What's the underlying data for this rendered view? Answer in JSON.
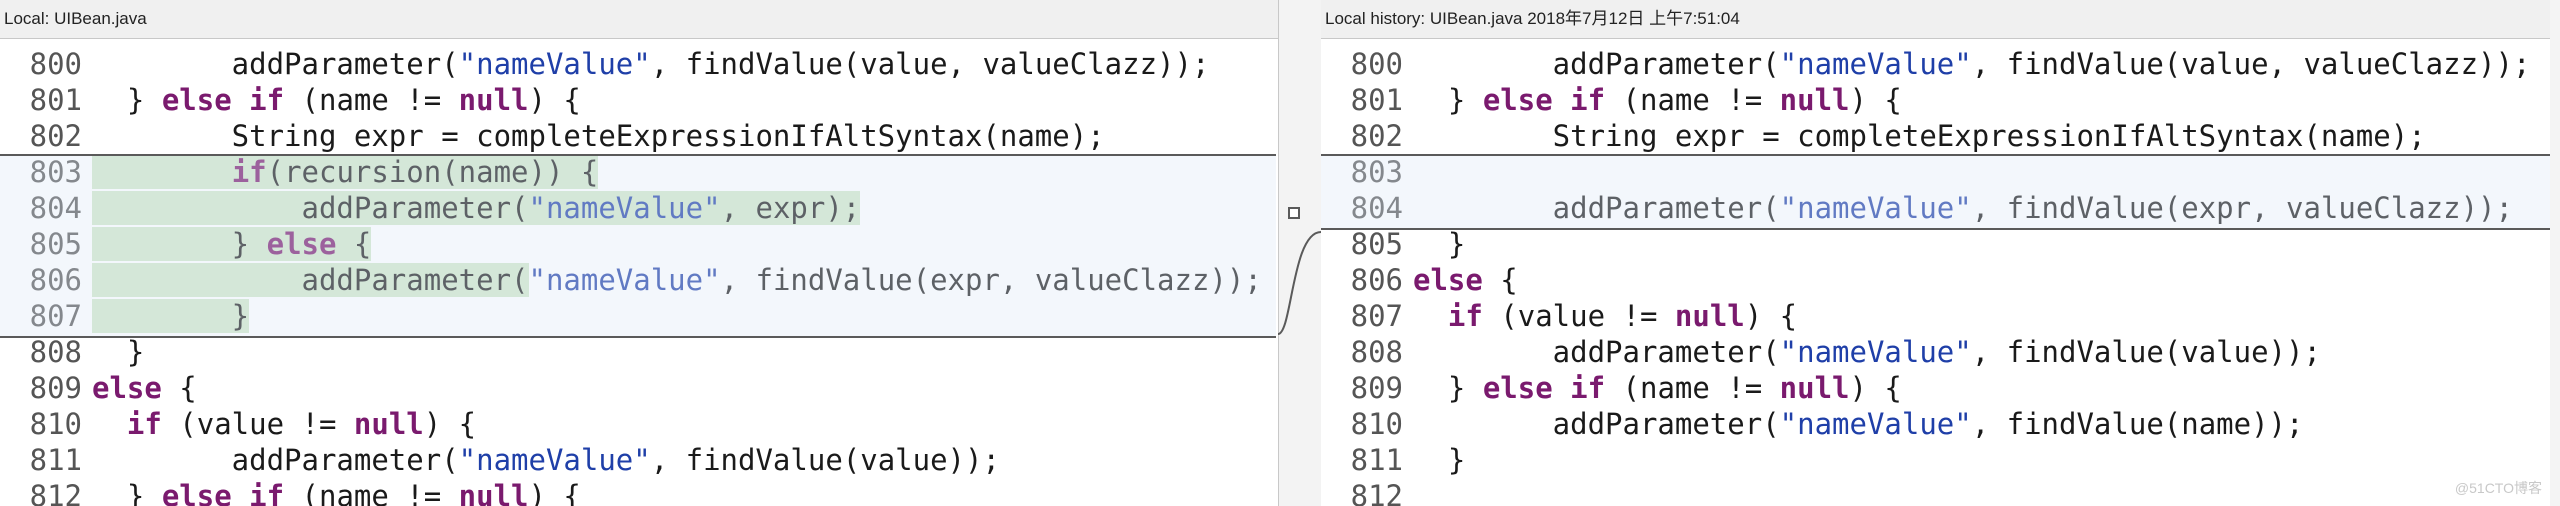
{
  "left": {
    "title": "Local: UIBean.java",
    "lines": [
      {
        "num": "800",
        "parts": [
          {
            "t": "        addParameter(",
            "c": ""
          },
          {
            "t": "\"nameValue\"",
            "c": "str"
          },
          {
            "t": ", findValue(value, valueClazz));",
            "c": ""
          }
        ]
      },
      {
        "num": "801",
        "parts": [
          {
            "t": "  } ",
            "c": ""
          },
          {
            "t": "else if",
            "c": "kw"
          },
          {
            "t": " (name != ",
            "c": ""
          },
          {
            "t": "null",
            "c": "kw"
          },
          {
            "t": ") {",
            "c": ""
          }
        ]
      },
      {
        "num": "802",
        "parts": [
          {
            "t": "        String expr = completeExpressionIfAltSyntax(name);",
            "c": ""
          }
        ]
      },
      {
        "num": "803",
        "parts": [
          {
            "t": "        ",
            "c": "hl"
          },
          {
            "t": "if",
            "c": "kw hl"
          },
          {
            "t": "(recursion(name)) {",
            "c": "hl"
          }
        ]
      },
      {
        "num": "804",
        "parts": [
          {
            "t": "            addParameter(",
            "c": "hl"
          },
          {
            "t": "\"nameValue\"",
            "c": "str hl"
          },
          {
            "t": ", expr);",
            "c": "hl"
          }
        ]
      },
      {
        "num": "805",
        "parts": [
          {
            "t": "        } ",
            "c": "hl"
          },
          {
            "t": "else",
            "c": "kw hl"
          },
          {
            "t": " {",
            "c": "hl"
          }
        ]
      },
      {
        "num": "806",
        "parts": [
          {
            "t": "            addParameter(",
            "c": "hl"
          },
          {
            "t": "\"nameValue\"",
            "c": "str"
          },
          {
            "t": ", findValue(expr, valueClazz));",
            "c": ""
          }
        ]
      },
      {
        "num": "807",
        "parts": [
          {
            "t": "        }",
            "c": "hl"
          }
        ]
      },
      {
        "num": "808",
        "parts": [
          {
            "t": "  }",
            "c": ""
          }
        ]
      },
      {
        "num": "809",
        "parts": [
          {
            "t": "else",
            "c": "kw"
          },
          {
            "t": " {",
            "c": ""
          }
        ]
      },
      {
        "num": "810",
        "parts": [
          {
            "t": "  ",
            "c": ""
          },
          {
            "t": "if",
            "c": "kw"
          },
          {
            "t": " (value != ",
            "c": ""
          },
          {
            "t": "null",
            "c": "kw"
          },
          {
            "t": ") {",
            "c": ""
          }
        ]
      },
      {
        "num": "811",
        "parts": [
          {
            "t": "        addParameter(",
            "c": ""
          },
          {
            "t": "\"nameValue\"",
            "c": "str"
          },
          {
            "t": ", findValue(value));",
            "c": ""
          }
        ]
      },
      {
        "num": "812",
        "parts": [
          {
            "t": "  } ",
            "c": ""
          },
          {
            "t": "else if",
            "c": "kw"
          },
          {
            "t": " (name != ",
            "c": ""
          },
          {
            "t": "null",
            "c": "kw"
          },
          {
            "t": ") {",
            "c": ""
          }
        ]
      }
    ]
  },
  "right": {
    "title": "Local history: UIBean.java 2018年7月12日 上午7:51:04",
    "lines": [
      {
        "num": "800",
        "parts": [
          {
            "t": "        addParameter(",
            "c": ""
          },
          {
            "t": "\"nameValue\"",
            "c": "str"
          },
          {
            "t": ", findValue(value, valueClazz));",
            "c": ""
          }
        ]
      },
      {
        "num": "801",
        "parts": [
          {
            "t": "  } ",
            "c": ""
          },
          {
            "t": "else if",
            "c": "kw"
          },
          {
            "t": " (name != ",
            "c": ""
          },
          {
            "t": "null",
            "c": "kw"
          },
          {
            "t": ") {",
            "c": ""
          }
        ]
      },
      {
        "num": "802",
        "parts": [
          {
            "t": "        String expr = completeExpressionIfAltSyntax(name);",
            "c": ""
          }
        ]
      },
      {
        "num": "803",
        "parts": []
      },
      {
        "num": "804",
        "parts": [
          {
            "t": "        addParameter(",
            "c": ""
          },
          {
            "t": "\"nameValue\"",
            "c": "str"
          },
          {
            "t": ", findValue(expr, valueClazz));",
            "c": ""
          }
        ]
      },
      {
        "num": "805",
        "parts": [
          {
            "t": "  }",
            "c": ""
          }
        ]
      },
      {
        "num": "806",
        "parts": [
          {
            "t": "else",
            "c": "kw"
          },
          {
            "t": " {",
            "c": ""
          }
        ]
      },
      {
        "num": "807",
        "parts": [
          {
            "t": "  ",
            "c": ""
          },
          {
            "t": "if",
            "c": "kw"
          },
          {
            "t": " (value != ",
            "c": ""
          },
          {
            "t": "null",
            "c": "kw"
          },
          {
            "t": ") {",
            "c": ""
          }
        ]
      },
      {
        "num": "808",
        "parts": [
          {
            "t": "        addParameter(",
            "c": ""
          },
          {
            "t": "\"nameValue\"",
            "c": "str"
          },
          {
            "t": ", findValue(value));",
            "c": ""
          }
        ]
      },
      {
        "num": "809",
        "parts": [
          {
            "t": "  } ",
            "c": ""
          },
          {
            "t": "else if",
            "c": "kw"
          },
          {
            "t": " (name != ",
            "c": ""
          },
          {
            "t": "null",
            "c": "kw"
          },
          {
            "t": ") {",
            "c": ""
          }
        ]
      },
      {
        "num": "810",
        "parts": [
          {
            "t": "        addParameter(",
            "c": ""
          },
          {
            "t": "\"nameValue\"",
            "c": "str"
          },
          {
            "t": ", findValue(name));",
            "c": ""
          }
        ]
      },
      {
        "num": "811",
        "parts": [
          {
            "t": "  }",
            "c": ""
          }
        ]
      },
      {
        "num": "812",
        "parts": []
      }
    ]
  },
  "watermark": "@51CTO博客",
  "colors": {
    "keyword": "#7a1a6e",
    "string": "#1f3fa8",
    "changed_bg": "#cfe6c8",
    "block_border": "#5a5a5a"
  }
}
